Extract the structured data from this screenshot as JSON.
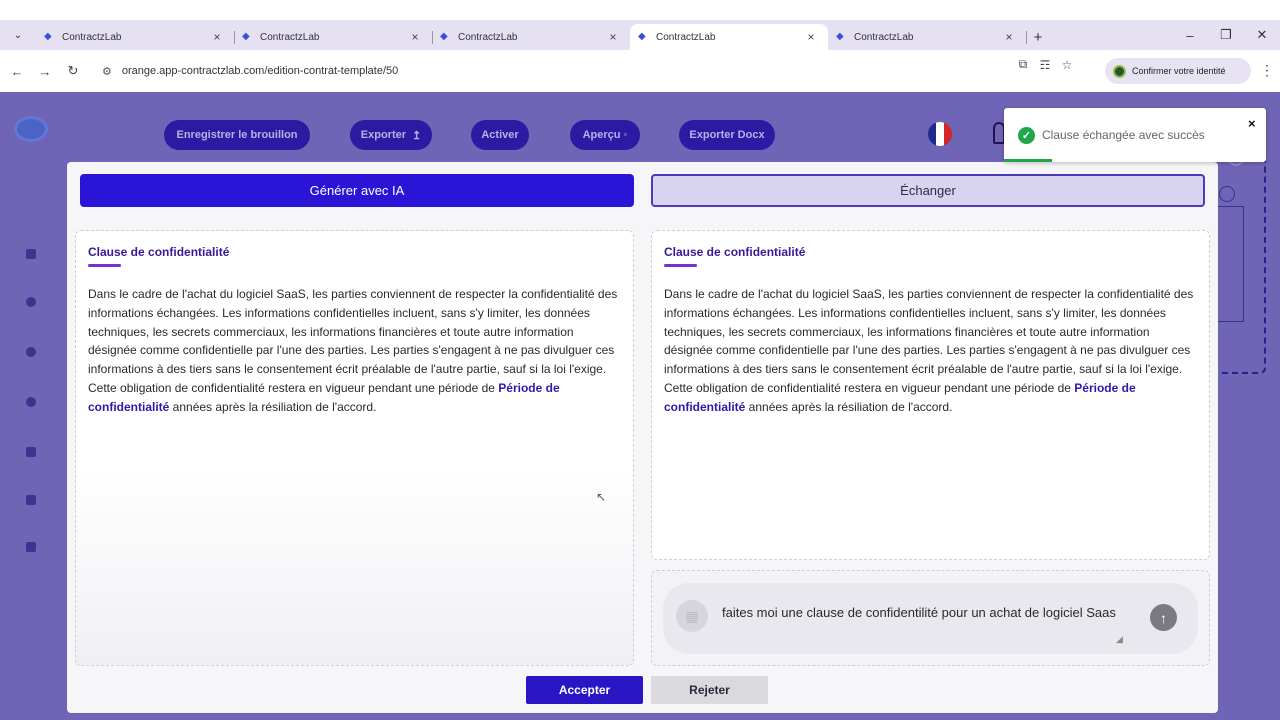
{
  "browser": {
    "tabs": [
      {
        "title": "ContractzLab"
      },
      {
        "title": "ContractzLab"
      },
      {
        "title": "ContractzLab"
      },
      {
        "title": "ContractzLab",
        "active": true
      },
      {
        "title": "ContractzLab"
      }
    ],
    "url": "orange.app-contractzlab.com/edition-contrat-template/50",
    "identity_label": "Confirmer votre identité"
  },
  "toolbar": {
    "save_draft": "Enregistrer le brouillon",
    "export": "Exporter",
    "activate": "Activer",
    "preview": "Aperçu",
    "export_docx": "Exporter Docx"
  },
  "modal": {
    "generate_tab": "Générer avec IA",
    "swap_tab": "Échanger",
    "left": {
      "title": "Clause de confidentialité",
      "text_before": "Dans le cadre de l'achat du logiciel SaaS, les parties conviennent de respecter la confidentialité des informations échangées. Les informations confidentielles incluent, sans s'y limiter, les données techniques, les secrets commerciaux, les informations financières et toute autre information désignée comme confidentielle par l'une des parties. Les parties s'engagent à ne pas divulguer ces informations à des tiers sans le consentement écrit préalable de l'autre partie, sauf si la loi l'exige. Cette obligation de confidentialité restera en vigueur pendant une période de ",
      "variable": "Période de confidentialité",
      "text_after": " années après la résiliation de l'accord."
    },
    "right": {
      "title": "Clause de confidentialité",
      "text_before": "Dans le cadre de l'achat du logiciel SaaS, les parties conviennent de respecter la confidentialité des informations échangées. Les informations confidentielles incluent, sans s'y limiter, les données techniques, les secrets commerciaux, les informations financières et toute autre information désignée comme confidentielle par l'une des parties. Les parties s'engagent à ne pas divulguer ces informations à des tiers sans le consentement écrit préalable de l'autre partie, sauf si la loi l'exige. Cette obligation de confidentialité restera en vigueur pendant une période de ",
      "variable": "Période de confidentialité",
      "text_after": " années après la résiliation de l'accord."
    },
    "prompt_text": "faites moi une clause de confidentilité pour un achat de logiciel Saas",
    "accept": "Accepter",
    "reject": "Rejeter"
  },
  "toast": {
    "message": "Clause échangée avec succès",
    "status_color": "#22a64a"
  },
  "colors": {
    "primary": "#2a15d6",
    "app_background": "#6f64b5",
    "clause_title": "#3a1896"
  }
}
